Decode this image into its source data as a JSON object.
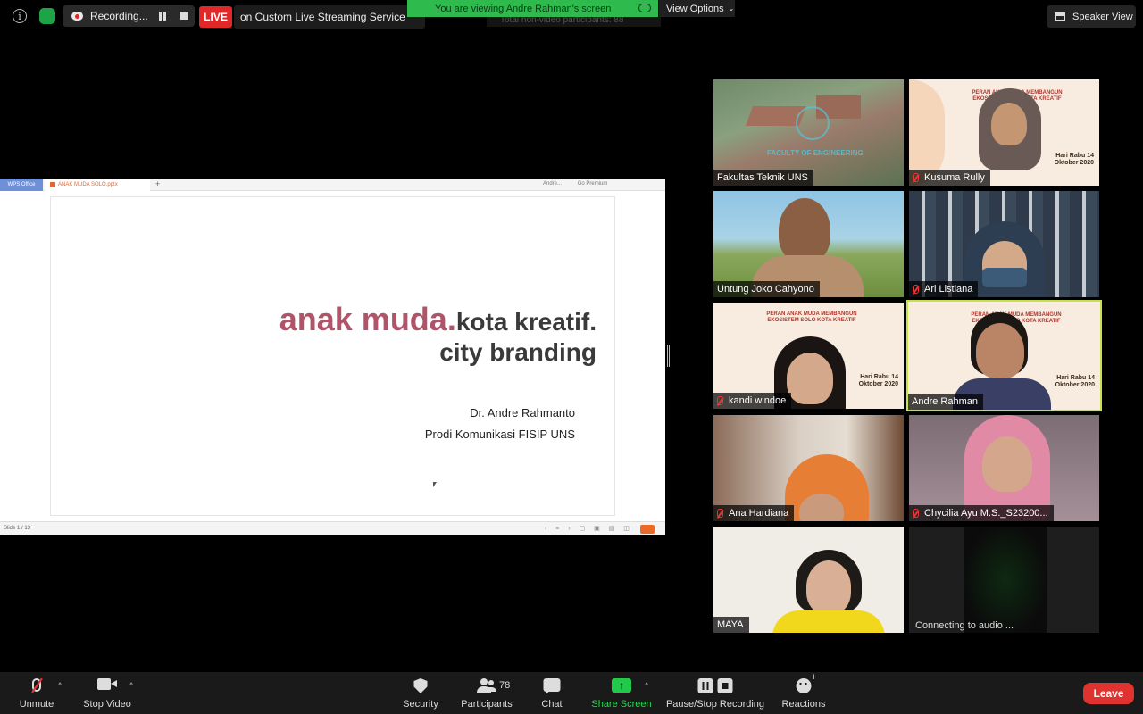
{
  "top_bar": {
    "recording_label": "Recording...",
    "live_badge": "LIVE",
    "live_service": "on Custom Live Streaming Service",
    "viewing_banner": "You are viewing Andre Rahman's screen",
    "view_options": "View Options",
    "speaker_view": "Speaker View",
    "ghost_text": "Total non-video participants: 88"
  },
  "shared_screen": {
    "app_tab": "WPS Office",
    "file_tab": "ANAK MUDA SOLO.pptx",
    "user_tab": "Andre...",
    "premium": "Go Premium",
    "slide_count": "Slide 1 / 13",
    "slide": {
      "title_pink": "anak muda.",
      "title_dark": "kota kreatif.",
      "subtitle": "city branding",
      "author": "Dr. Andre Rahmanto",
      "affiliation": "Prodi Komunikasi FISIP UNS"
    }
  },
  "participants": [
    {
      "name": "Fakultas Teknik UNS",
      "muted": false
    },
    {
      "name": "Kusuma Rully",
      "muted": true
    },
    {
      "name": "Untung Joko Cahyono",
      "muted": false
    },
    {
      "name": "Ari Listiana",
      "muted": true
    },
    {
      "name": "kandi windoe",
      "muted": true
    },
    {
      "name": "Andre Rahman",
      "muted": false
    },
    {
      "name": "Ana Hardiana",
      "muted": true
    },
    {
      "name": "Chycilia Ayu M.S._S23200...",
      "muted": true
    },
    {
      "name": "MAYA",
      "muted": false
    },
    {
      "name": "Connecting to audio ...",
      "muted": false
    }
  ],
  "posters": {
    "title": "PERAN ANAK MUDA MEMBANGUN EKOSISTEM SOLO KOTA KREATIF",
    "date": "Hari Rabu 14 Oktober 2020"
  },
  "campus_overlay": "FACULTY OF ENGINEERING",
  "toolbar": {
    "unmute": "Unmute",
    "stop_video": "Stop Video",
    "security": "Security",
    "participants": "Participants",
    "participant_count": "78",
    "chat": "Chat",
    "share_screen": "Share Screen",
    "pause_stop_recording": "Pause/Stop Recording",
    "reactions": "Reactions",
    "leave": "Leave"
  },
  "colors": {
    "live_red": "#e02828",
    "banner_green": "#2fba4e",
    "share_green": "#20c94a",
    "active_speaker": "#c8e04a",
    "slide_pink": "#b25469",
    "leave_red": "#e0322f"
  }
}
